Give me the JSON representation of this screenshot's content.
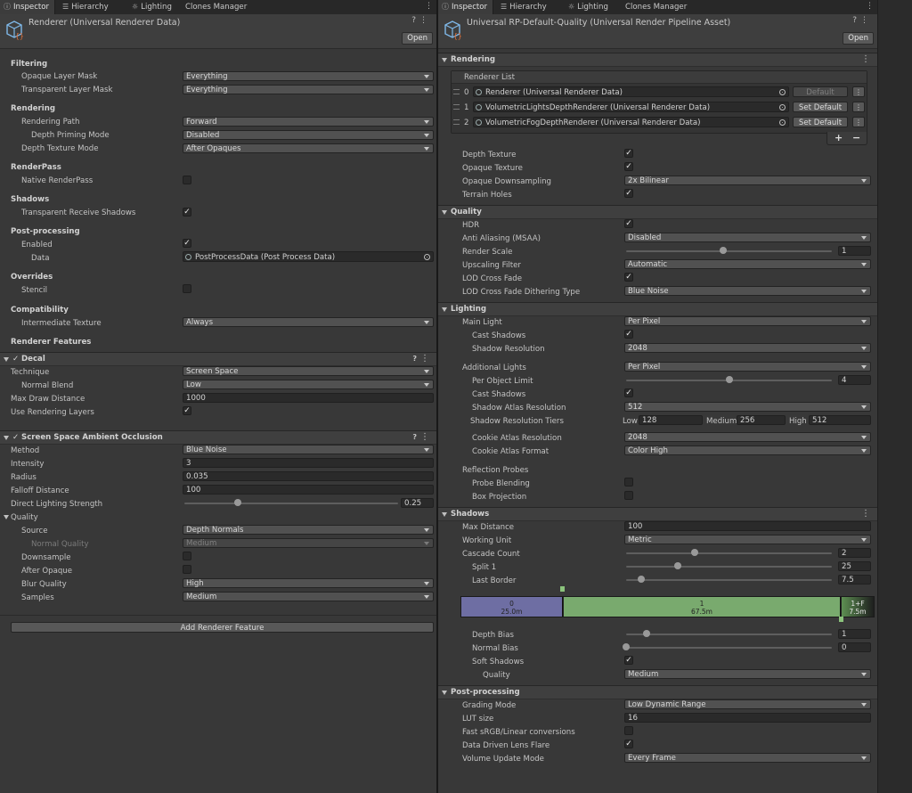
{
  "left": {
    "tabs": [
      {
        "icon": "info-icon",
        "label": "Inspector",
        "active": true
      },
      {
        "icon": "hierarchy-icon",
        "label": "Hierarchy"
      },
      {
        "icon": "lighting-icon",
        "label": "Lighting"
      },
      {
        "icon": "",
        "label": "Clones Manager"
      }
    ],
    "header": {
      "title": "Renderer (Universal Renderer Data)",
      "open_label": "Open"
    },
    "filtering": {
      "title": "Filtering",
      "opaque_label": "Opaque Layer Mask",
      "opaque_value": "Everything",
      "transparent_label": "Transparent Layer Mask",
      "transparent_value": "Everything"
    },
    "rendering": {
      "title": "Rendering",
      "path_label": "Rendering Path",
      "path_value": "Forward",
      "priming_label": "Depth Priming Mode",
      "priming_value": "Disabled",
      "depth_tex_label": "Depth Texture Mode",
      "depth_tex_value": "After Opaques"
    },
    "renderpass": {
      "title": "RenderPass",
      "native_label": "Native RenderPass",
      "native_checked": false
    },
    "shadows": {
      "title": "Shadows",
      "trs_label": "Transparent Receive Shadows",
      "trs_checked": true
    },
    "postprocessing": {
      "title": "Post-processing",
      "enabled_label": "Enabled",
      "enabled_checked": true,
      "data_label": "Data",
      "data_value": "PostProcessData (Post Process Data)"
    },
    "overrides": {
      "title": "Overrides",
      "stencil_label": "Stencil",
      "stencil_checked": false
    },
    "compat": {
      "title": "Compatibility",
      "inter_label": "Intermediate Texture",
      "inter_value": "Always"
    },
    "features_title": "Renderer Features",
    "decal": {
      "title": "Decal",
      "technique_label": "Technique",
      "technique_value": "Screen Space",
      "normal_blend_label": "Normal Blend",
      "normal_blend_value": "Low",
      "max_draw_label": "Max Draw Distance",
      "max_draw_value": "1000",
      "layers_label": "Use Rendering Layers",
      "layers_checked": true
    },
    "ssao": {
      "title": "Screen Space Ambient Occlusion",
      "method_label": "Method",
      "method_value": "Blue Noise",
      "intensity_label": "Intensity",
      "intensity_value": "3",
      "radius_label": "Radius",
      "radius_value": "0.035",
      "falloff_label": "Falloff Distance",
      "falloff_value": "100",
      "direct_label": "Direct Lighting Strength",
      "direct_value": "0.25",
      "quality_label": "Quality",
      "source_label": "Source",
      "source_value": "Depth Normals",
      "normal_quality_label": "Normal Quality",
      "normal_quality_value": "Medium",
      "downsample_label": "Downsample",
      "downsample_checked": false,
      "after_opaque_label": "After Opaque",
      "after_opaque_checked": false,
      "blur_label": "Blur Quality",
      "blur_value": "High",
      "samples_label": "Samples",
      "samples_value": "Medium"
    },
    "add_feature_label": "Add Renderer Feature"
  },
  "right": {
    "tabs": [
      {
        "icon": "info-icon",
        "label": "Inspector",
        "active": true
      },
      {
        "icon": "hierarchy-icon",
        "label": "Hierarchy"
      },
      {
        "icon": "lighting-icon",
        "label": "Lighting"
      },
      {
        "icon": "",
        "label": "Clones Manager"
      }
    ],
    "header": {
      "title": "Universal RP-Default-Quality (Universal Render Pipeline Asset)",
      "open_label": "Open"
    },
    "rendering": {
      "title": "Rendering",
      "list_title": "Renderer List",
      "renderers": [
        {
          "index": "0",
          "name": "Renderer (Universal Renderer Data)",
          "button": "Default",
          "is_default": true
        },
        {
          "index": "1",
          "name": "VolumetricLightsDepthRenderer (Universal Renderer Data)",
          "button": "Set Default",
          "is_default": false
        },
        {
          "index": "2",
          "name": "VolumetricFogDepthRenderer (Universal Renderer Data)",
          "button": "Set Default",
          "is_default": false
        }
      ],
      "add_label": "+",
      "remove_label": "−",
      "depth_tex_label": "Depth Texture",
      "depth_tex_checked": true,
      "opaque_tex_label": "Opaque Texture",
      "opaque_tex_checked": true,
      "downsampling_label": "Opaque Downsampling",
      "downsampling_value": "2x Bilinear",
      "terrain_label": "Terrain Holes",
      "terrain_checked": true
    },
    "quality": {
      "title": "Quality",
      "hdr_label": "HDR",
      "hdr_checked": true,
      "aa_label": "Anti Aliasing (MSAA)",
      "aa_value": "Disabled",
      "scale_label": "Render Scale",
      "scale_value": "1",
      "upscale_label": "Upscaling Filter",
      "upscale_value": "Automatic",
      "lod_label": "LOD Cross Fade",
      "lod_checked": true,
      "lod_dither_label": "LOD Cross Fade Dithering Type",
      "lod_dither_value": "Blue Noise"
    },
    "lighting": {
      "title": "Lighting",
      "main_label": "Main Light",
      "main_value": "Per Pixel",
      "cast_label": "Cast Shadows",
      "cast_checked": true,
      "shadow_res_label": "Shadow Resolution",
      "shadow_res_value": "2048",
      "add_label": "Additional Lights",
      "add_value": "Per Pixel",
      "per_obj_label": "Per Object Limit",
      "per_obj_value": "4",
      "add_cast_label": "Cast Shadows",
      "add_cast_checked": true,
      "atlas_label": "Shadow Atlas Resolution",
      "atlas_value": "512",
      "tiers_label": "Shadow Resolution Tiers",
      "tier_low_label": "Low",
      "tier_low_value": "128",
      "tier_med_label": "Medium",
      "tier_med_value": "256",
      "tier_high_label": "High",
      "tier_high_value": "512",
      "cookie_res_label": "Cookie Atlas Resolution",
      "cookie_res_value": "2048",
      "cookie_fmt_label": "Cookie Atlas Format",
      "cookie_fmt_value": "Color High",
      "probes_label": "Reflection Probes",
      "blend_label": "Probe Blending",
      "blend_checked": false,
      "box_label": "Box Projection",
      "box_checked": false
    },
    "shadows": {
      "title": "Shadows",
      "maxdist_label": "Max Distance",
      "maxdist_value": "100",
      "unit_label": "Working Unit",
      "unit_value": "Metric",
      "cascade_label": "Cascade Count",
      "cascade_value": "2",
      "split_label": "Split 1",
      "split_value": "25",
      "border_label": "Last Border",
      "border_value": "7.5",
      "cascades": [
        {
          "index": "0",
          "distance": "25.0m",
          "color": "#6e6ea3"
        },
        {
          "index": "1",
          "distance": "67.5m",
          "color": "#79aa6e"
        },
        {
          "index": "1+F",
          "distance": "7.5m",
          "color": "#5a8a4e"
        }
      ],
      "bias_label": "Depth Bias",
      "bias_value": "1",
      "normal_bias_label": "Normal Bias",
      "normal_bias_value": "0",
      "soft_label": "Soft Shadows",
      "soft_checked": true,
      "quality_label": "Quality",
      "quality_value": "Medium"
    },
    "post": {
      "title": "Post-processing",
      "grading_label": "Grading Mode",
      "grading_value": "Low Dynamic Range",
      "lut_label": "LUT size",
      "lut_value": "16",
      "srgb_label": "Fast sRGB/Linear conversions",
      "srgb_checked": false,
      "flare_label": "Data Driven Lens Flare",
      "flare_checked": true,
      "volume_label": "Volume Update Mode",
      "volume_value": "Every Frame"
    }
  },
  "sliders": {
    "direct_lighting": 0.25,
    "render_scale": 1,
    "per_object_limit": 4,
    "cascade_count": 2,
    "split_1": 25,
    "last_border": 7.5,
    "depth_bias": 1,
    "normal_bias": 0
  },
  "colors": {
    "accent_check": "#e6e6e6",
    "panel_bg": "#383838",
    "section_bg": "#3f3f3f"
  }
}
